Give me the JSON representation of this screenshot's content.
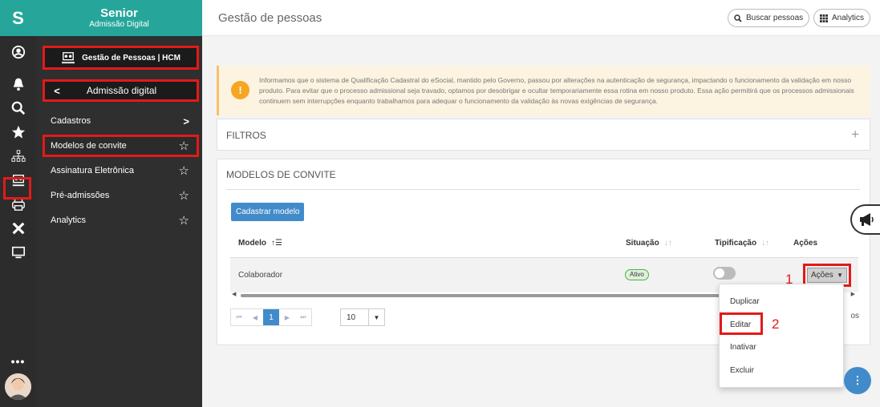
{
  "rail": {
    "logo": "S",
    "icons": [
      "user-circle-icon",
      "bell-icon",
      "search-icon",
      "star-icon",
      "org-chart-icon",
      "hcm-people-icon",
      "printer-icon",
      "close-x-icon",
      "monitor-icon"
    ],
    "more": "•••"
  },
  "menu": {
    "brand": "Senior",
    "brand_sub": "Admissão Digital",
    "section": "Gestão de Pessoas | HCM",
    "back_chevron": "<",
    "module": "Admissão digital",
    "items": [
      {
        "label": "Cadastros",
        "trail": ">"
      },
      {
        "label": "Modelos de convite",
        "trail": "☆"
      },
      {
        "label": "Assinatura Eletrônica",
        "trail": "☆"
      },
      {
        "label": "Pré-admissões",
        "trail": "☆"
      },
      {
        "label": "Analytics",
        "trail": "☆"
      }
    ]
  },
  "header": {
    "title": "Gestão de pessoas",
    "search_btn": "Buscar pessoas",
    "analytics_btn": "Analytics"
  },
  "alert": {
    "icon": "!",
    "text": "Informamos que o sistema de Qualificação Cadastral do eSocial, mantido pelo Governo, passou por alterações na autenticação de segurança, impactando o funcionamento da validação em nosso produto. Para evitar que o processo admissional seja travado, optamos por desobrigar e ocultar temporariamente essa rotina em nosso produto. Essa ação permitirá que os processos admissionais continuem sem interrupções enquanto trabalhamos para adequar o funcionamento da validação às novas exigências de segurança."
  },
  "filters": {
    "title": "FILTROS",
    "expand": "+"
  },
  "models": {
    "title": "MODELOS DE CONVITE",
    "add_button": "Cadastrar modelo",
    "columns": [
      "Modelo",
      "Situação",
      "Tipificação",
      "Ações"
    ],
    "rows": [
      {
        "modelo": "Colaborador",
        "situacao": "Ativo",
        "tipificacao_on": false,
        "acoes": "Ações"
      }
    ],
    "pager": {
      "first": "⏮",
      "prev": "◀",
      "current": "1",
      "next": "▶",
      "last": "⏭"
    },
    "page_size": "10",
    "tail": "os"
  },
  "actions_menu": {
    "items": [
      "Duplicar",
      "Editar",
      "Inativar",
      "Excluir"
    ]
  },
  "annotations": {
    "one": "1",
    "two": "2"
  },
  "colors": {
    "teal": "#26a69a",
    "highlight_red": "#e21a1a",
    "primary_blue": "#428bca"
  }
}
